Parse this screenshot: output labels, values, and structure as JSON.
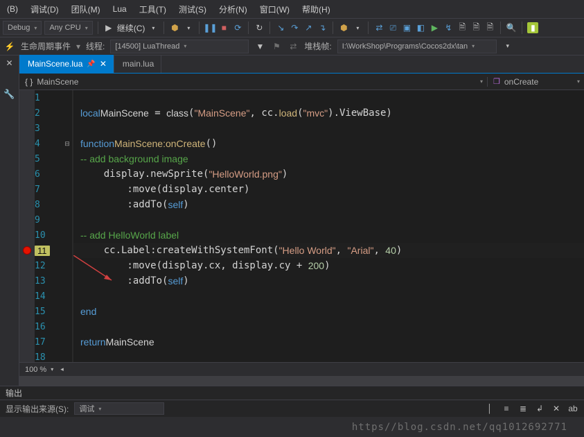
{
  "menu": [
    "(B)",
    "调试(D)",
    "团队(M)",
    "Lua",
    "工具(T)",
    "测试(S)",
    "分析(N)",
    "窗口(W)",
    "帮助(H)"
  ],
  "toolbar": {
    "config": "Debug",
    "platform": "Any CPU",
    "continue_label": "继续(C)"
  },
  "thread": {
    "life_events": "生命周期事件",
    "thread_label": "线程:",
    "thread_value": "[14500] LuaThread",
    "stack_label": "堆栈帧:",
    "stack_value": "I:\\WorkShop\\Programs\\Cocos2dx\\tan"
  },
  "tabs": {
    "active": "MainScene.lua",
    "other": "main.lua"
  },
  "navbar": {
    "scope": "MainScene",
    "member": "onCreate"
  },
  "code": {
    "lines": [
      {
        "n": 1,
        "html": ""
      },
      {
        "n": 2,
        "html": "<span class='kw'>local</span> <span class='id'>MainScene</span> = <span class='id'>class</span>(<span class='str'>\"MainScene\"</span>, cc.<span class='fn'>load</span>(<span class='str'>\"mvc\"</span>).ViewBase)"
      },
      {
        "n": 3,
        "html": ""
      },
      {
        "n": 4,
        "html": "<span class='kw'>function</span> <span class='fn'>MainScene:onCreate</span>()",
        "fold": "⊟"
      },
      {
        "n": 5,
        "html": "    <span class='cm'>-- add background image</span>"
      },
      {
        "n": 6,
        "html": "    display.newSprite(<span class='str'>\"HelloWorld.png\"</span>)"
      },
      {
        "n": 7,
        "html": "        :move(display.center)"
      },
      {
        "n": 8,
        "html": "        :addTo(<span class='self'>self</span>)"
      },
      {
        "n": 9,
        "html": ""
      },
      {
        "n": 10,
        "html": "    <span class='cm'>-- add HelloWorld label</span>"
      },
      {
        "n": 11,
        "html": "    cc.Label:createWithSystemFont(<span class='str'>\"Hello World\"</span>, <span class='str'>\"Arial\"</span>, <span class='num'>40</span>)",
        "bp": true,
        "hl": true
      },
      {
        "n": 12,
        "html": "        :move(display.cx, display.cy + <span class='num'>200</span>)"
      },
      {
        "n": 13,
        "html": "        :addTo(<span class='self'>self</span>)"
      },
      {
        "n": 14,
        "html": ""
      },
      {
        "n": 15,
        "html": "<span class='kw'>end</span>"
      },
      {
        "n": 16,
        "html": ""
      },
      {
        "n": 17,
        "html": "<span class='kw'>return</span> <span class='id'>MainScene</span>"
      },
      {
        "n": 18,
        "html": ""
      }
    ]
  },
  "zoom": "100 %",
  "output": {
    "title": "输出",
    "source_label": "显示输出来源(S):",
    "source_value": "调试"
  },
  "watermark": "https//blog.csdn.net/qq1012692771"
}
